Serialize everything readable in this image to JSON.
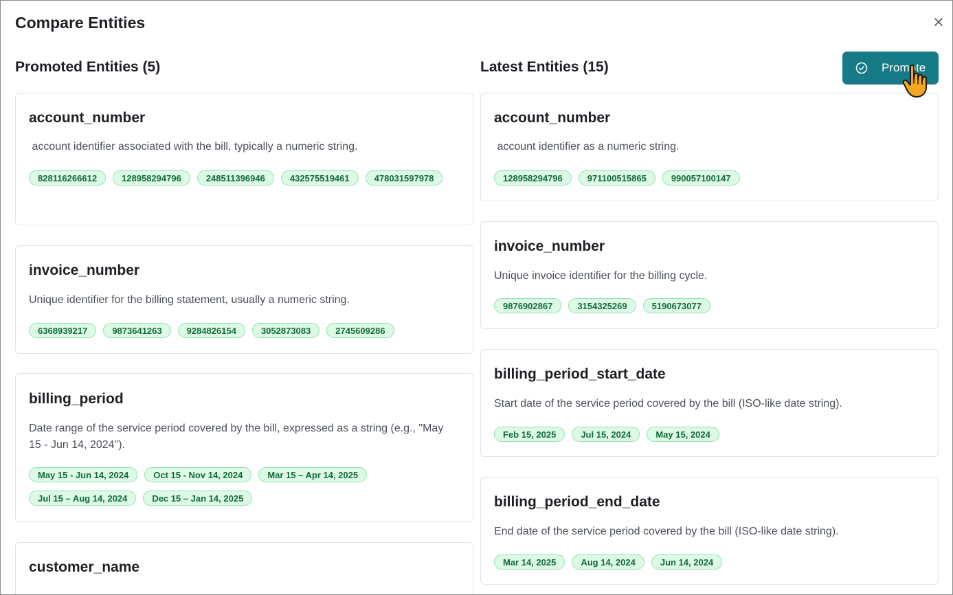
{
  "dialog": {
    "title": "Compare Entities",
    "close_icon": "close-icon"
  },
  "promoted": {
    "heading": "Promoted Entities (5)",
    "entities": [
      {
        "name": "account_number",
        "description": " account identifier associated with the bill, typically a numeric string.",
        "values": [
          "828116266612",
          "128958294796",
          "248511396946",
          "432575519461",
          "478031597978"
        ]
      },
      {
        "name": "invoice_number",
        "description": "Unique identifier for the billing statement, usually a numeric string.",
        "values": [
          "6368939217",
          "9873641263",
          "9284826154",
          "3052873083",
          "2745609286"
        ]
      },
      {
        "name": "billing_period",
        "description": "Date range of the service period covered by the bill, expressed as a string (e.g., \"May 15 - Jun 14, 2024\").",
        "values": [
          "May 15 - Jun 14, 2024",
          "Oct 15 - Nov 14, 2024",
          "Mar 15 – Apr 14, 2025",
          "Jul 15 – Aug 14, 2024",
          "Dec 15 – Jan 14, 2025"
        ]
      },
      {
        "name": "customer_name",
        "description": "",
        "values": []
      }
    ]
  },
  "latest": {
    "heading": "Latest Entities (15)",
    "promote_button": {
      "label": "Promote",
      "icon": "check-circle-icon"
    },
    "entities": [
      {
        "name": "account_number",
        "description": " account identifier as a numeric string.",
        "values": [
          "128958294796",
          "971100515865",
          "990057100147"
        ]
      },
      {
        "name": "invoice_number",
        "description": "Unique invoice identifier for the billing cycle.",
        "values": [
          "9876902867",
          "3154325269",
          "5190673077"
        ]
      },
      {
        "name": "billing_period_start_date",
        "description": "Start date of the service period covered by the bill (ISO-like date string).",
        "values": [
          "Feb 15, 2025",
          "Jul 15, 2024",
          "May 15, 2024"
        ]
      },
      {
        "name": "billing_period_end_date",
        "description": "End date of the service period covered by the bill (ISO-like date string).",
        "values": [
          "Mar 14, 2025",
          "Aug 14, 2024",
          "Jun 14, 2024"
        ]
      }
    ]
  },
  "colors": {
    "accent": "#167b86",
    "chip_bg": "#dcfae6",
    "chip_border": "#8fe3ad",
    "chip_text": "#136b38"
  },
  "cursor_icon": "hand-pointer-icon"
}
